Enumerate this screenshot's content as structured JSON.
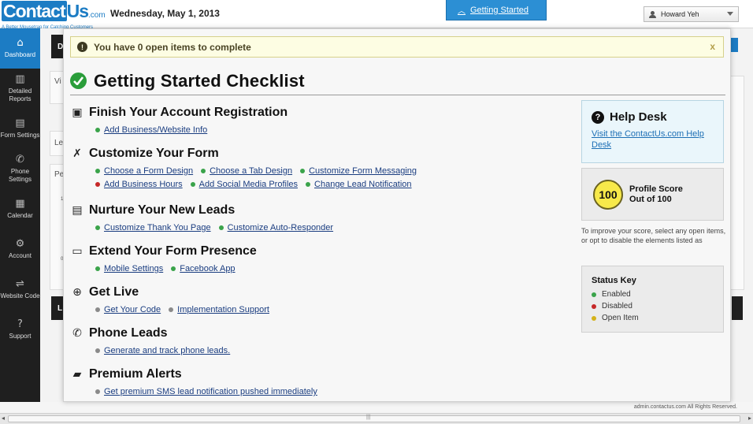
{
  "header": {
    "logo": {
      "part1": "Contact",
      "part2": "Us",
      "domain": ".com",
      "tagline": "A Better Mousetrap for Catching Customers"
    },
    "date": "Wednesday, May 1, 2013",
    "getting_started_label": "Getting Started",
    "user_name": "Howard Yeh"
  },
  "sidebar": {
    "items": [
      {
        "label": "Dashboard",
        "icon": "home-icon",
        "glyph": "⌂",
        "active": true
      },
      {
        "label": "Detailed Reports",
        "icon": "bar-chart-icon",
        "glyph": "▥",
        "active": false
      },
      {
        "label": "Form Settings",
        "icon": "form-icon",
        "glyph": "▤",
        "active": false
      },
      {
        "label": "Phone Settings",
        "icon": "phone-icon",
        "glyph": "✆",
        "active": false
      },
      {
        "label": "Calendar",
        "icon": "calendar-icon",
        "glyph": "▦",
        "active": false
      },
      {
        "label": "Account",
        "icon": "gear-icon",
        "glyph": "⚙",
        "active": false
      },
      {
        "label": "Website Code",
        "icon": "code-icon",
        "glyph": "⇌",
        "active": false
      },
      {
        "label": "Support",
        "icon": "question-icon",
        "glyph": "?",
        "active": false
      }
    ]
  },
  "background": {
    "partial_labels": [
      "D",
      "Vi",
      "Le",
      "Pe",
      "1",
      "0",
      "L"
    ]
  },
  "notice": {
    "text": "You have 0 open items to complete",
    "close": "x"
  },
  "modal": {
    "title": "Getting Started Checklist"
  },
  "sections": [
    {
      "title": "Finish Your Account Registration",
      "icon": "id-card-icon",
      "glyph": "▣",
      "rows": [
        [
          {
            "label": "Add Business/Website Info",
            "status": "enabled"
          }
        ]
      ]
    },
    {
      "title": "Customize Your Form",
      "icon": "tools-icon",
      "glyph": "✗",
      "rows": [
        [
          {
            "label": "Choose a Form Design",
            "status": "enabled"
          },
          {
            "label": "Choose a Tab Design",
            "status": "enabled"
          },
          {
            "label": "Customize Form Messaging",
            "status": "enabled"
          }
        ],
        [
          {
            "label": "Add Business Hours",
            "status": "disabled"
          },
          {
            "label": "Add Social Media Profiles",
            "status": "enabled"
          },
          {
            "label": "Change Lead Notification",
            "status": "enabled"
          }
        ]
      ]
    },
    {
      "title": "Nurture Your New Leads",
      "icon": "document-icon",
      "glyph": "▤",
      "rows": [
        [
          {
            "label": "Customize Thank You Page",
            "status": "enabled"
          },
          {
            "label": "Customize Auto-Responder",
            "status": "enabled"
          }
        ]
      ]
    },
    {
      "title": "Extend Your Form Presence",
      "icon": "window-icon",
      "glyph": "▭",
      "rows": [
        [
          {
            "label": "Mobile Settings",
            "status": "enabled"
          },
          {
            "label": "Facebook App",
            "status": "enabled"
          }
        ]
      ]
    },
    {
      "title": "Get Live",
      "icon": "globe-icon",
      "glyph": "⊕",
      "rows": [
        [
          {
            "label": "Get Your Code",
            "status": "neutral"
          },
          {
            "label": "Implementation Support",
            "status": "neutral"
          }
        ]
      ]
    },
    {
      "title": "Phone Leads",
      "icon": "phone-icon",
      "glyph": "✆",
      "rows": [
        [
          {
            "label": "Generate and track phone leads.",
            "status": "neutral"
          }
        ]
      ]
    },
    {
      "title": "Premium Alerts",
      "icon": "chat-icon",
      "glyph": "▰",
      "rows": [
        [
          {
            "label": "Get premium SMS lead notification pushed immediately",
            "status": "neutral"
          }
        ]
      ]
    }
  ],
  "help_desk": {
    "title": "Help Desk",
    "link": "Visit the ContactUs.com Help Desk"
  },
  "profile_score": {
    "value": "100",
    "label_line1": "Profile Score",
    "label_line2": "Out of 100",
    "score_percent": 100
  },
  "score_note": "To improve your score, select any open items, or opt to disable the elements listed as",
  "status_key": {
    "title": "Status Key",
    "items": [
      {
        "label": "Enabled",
        "status": "enabled"
      },
      {
        "label": "Disabled",
        "status": "disabled"
      },
      {
        "label": "Open Item",
        "status": "open"
      }
    ]
  },
  "colors": {
    "enabled": "#3aa34a",
    "disabled": "#c62828",
    "open": "#d4b21a",
    "neutral": "#8a8a8a",
    "accent": "#1c7cc4"
  },
  "footer": {
    "text": "admin.contactus.com All Rights Reserved."
  },
  "scrollbar": {
    "grip": "|||"
  }
}
